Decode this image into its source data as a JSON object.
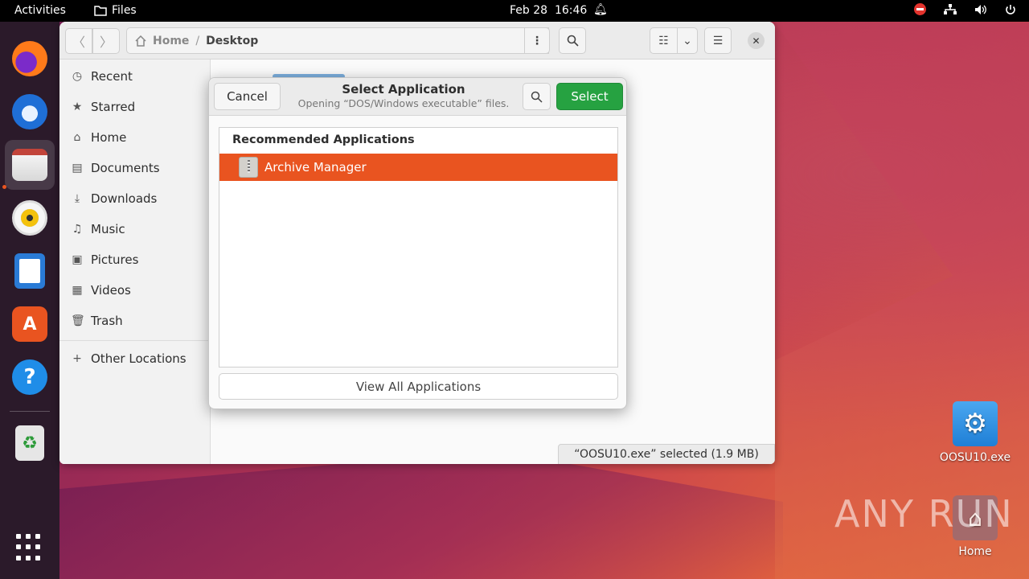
{
  "topbar": {
    "activities": "Activities",
    "app_name": "Files",
    "date": "Feb 28",
    "time": "16:46"
  },
  "dock": {
    "items": [
      "firefox-icon",
      "thunderbird-icon",
      "files-icon",
      "rhythmbox-icon",
      "libreoffice-writer-icon",
      "app-center-icon",
      "help-icon",
      "trash-icon"
    ],
    "active": "files-icon"
  },
  "file_manager": {
    "path": {
      "home": "Home",
      "separator": "/",
      "current": "Desktop"
    },
    "sidebar": [
      {
        "label": "Recent",
        "icon": "clock-icon"
      },
      {
        "label": "Starred",
        "icon": "star-icon"
      },
      {
        "label": "Home",
        "icon": "home-icon"
      },
      {
        "label": "Documents",
        "icon": "document-icon"
      },
      {
        "label": "Downloads",
        "icon": "download-icon"
      },
      {
        "label": "Music",
        "icon": "music-icon"
      },
      {
        "label": "Pictures",
        "icon": "picture-icon"
      },
      {
        "label": "Videos",
        "icon": "video-icon"
      },
      {
        "label": "Trash",
        "icon": "trash-icon"
      },
      {
        "label": "Other Locations",
        "icon": "plus-icon"
      }
    ],
    "status": "“OOSU10.exe” selected  (1.9 MB)"
  },
  "dialog": {
    "cancel": "Cancel",
    "title": "Select Application",
    "subtitle": "Opening “DOS/Windows executable” files.",
    "select": "Select",
    "list_header": "Recommended Applications",
    "apps": [
      {
        "name": "Archive Manager",
        "selected": true
      }
    ],
    "view_all": "View All Applications"
  },
  "desktop": {
    "icons": [
      {
        "label": "OOSU10.exe"
      },
      {
        "label": "Home"
      }
    ]
  },
  "watermark": "ANY RUN",
  "colors": {
    "accent": "#e95420",
    "select_green": "#26a241",
    "topbar": "#000000"
  }
}
